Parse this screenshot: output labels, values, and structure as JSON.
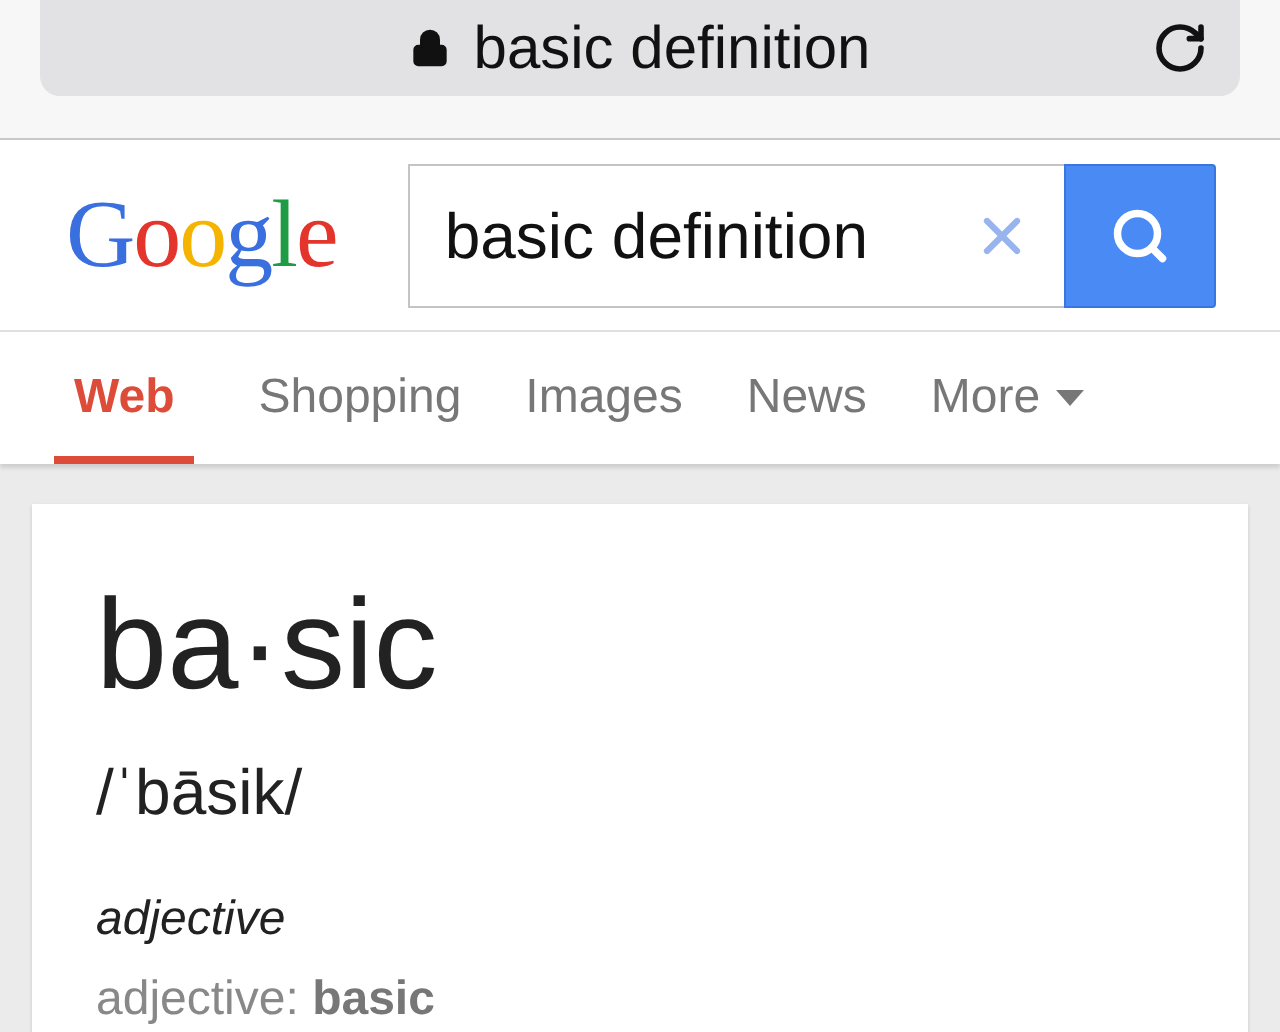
{
  "address_bar": {
    "url": "basic definition",
    "secure": true
  },
  "logo": {
    "letters": [
      {
        "char": "G",
        "color": "#3a6fe0"
      },
      {
        "char": "o",
        "color": "#e3352b"
      },
      {
        "char": "o",
        "color": "#f4b400"
      },
      {
        "char": "g",
        "color": "#3a6fe0"
      },
      {
        "char": "l",
        "color": "#1e9b45"
      },
      {
        "char": "e",
        "color": "#e3352b"
      }
    ]
  },
  "search": {
    "value": "basic definition"
  },
  "tabs": [
    {
      "label": "Web",
      "selected": true
    },
    {
      "label": "Shopping",
      "selected": false
    },
    {
      "label": "Images",
      "selected": false
    },
    {
      "label": "News",
      "selected": false
    },
    {
      "label": "More",
      "selected": false,
      "kind": "menu"
    }
  ],
  "definition": {
    "word": "ba·sic",
    "pronunciation": "/ˈbāsik/",
    "part_of_speech": "adjective",
    "forms": "adjective: **basic**"
  }
}
